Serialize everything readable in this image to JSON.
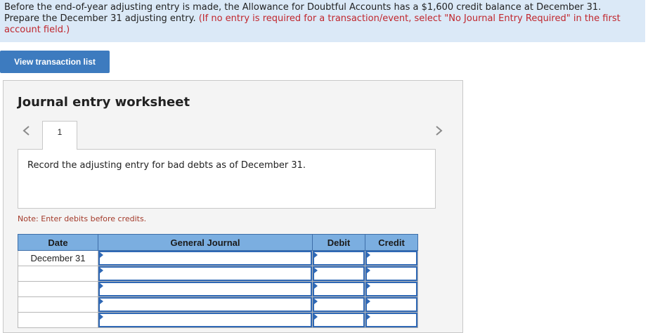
{
  "instructions": {
    "line1": "Before the end-of-year adjusting entry is made, the Allowance for Doubtful Accounts has a $1,600 credit balance at December 31.",
    "line2_black": "Prepare the December 31 adjusting entry. ",
    "line2_red": "(If no entry is required for a transaction/event, select \"No Journal Entry Required\" in the first account field.)"
  },
  "view_button_label": "View transaction list",
  "worksheet": {
    "title": "Journal entry worksheet",
    "tab_label": "1",
    "prompt": "Record the adjusting entry for bad debts as of December 31.",
    "note": "Note: Enter debits before credits."
  },
  "table": {
    "headers": {
      "date": "Date",
      "general_journal": "General Journal",
      "debit": "Debit",
      "credit": "Credit"
    },
    "rows": [
      {
        "date": "December 31"
      },
      {
        "date": ""
      },
      {
        "date": ""
      },
      {
        "date": ""
      },
      {
        "date": ""
      }
    ]
  },
  "colors": {
    "instruction_bg": "#dbe9f7",
    "button_blue": "#3d7bbf",
    "header_blue": "#7baee0",
    "input_border": "#2f68b5",
    "note_red": "#a33a2a"
  }
}
